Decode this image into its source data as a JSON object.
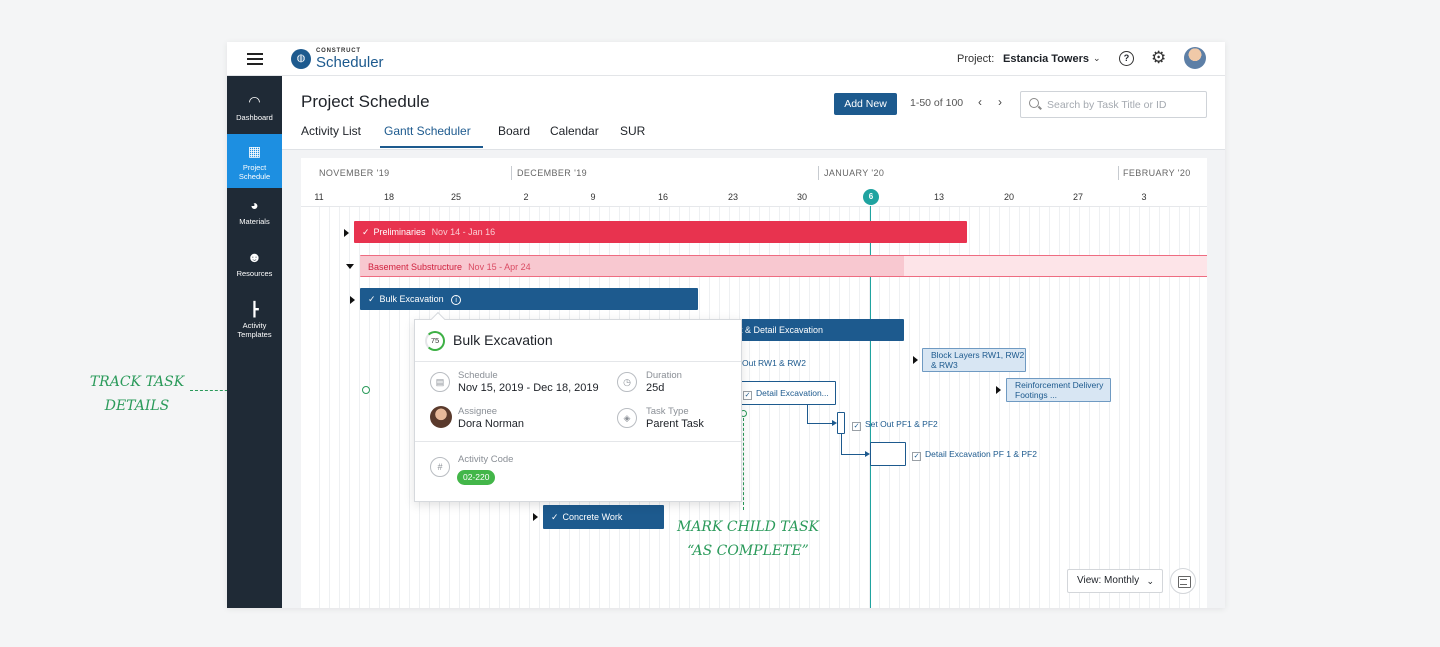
{
  "header": {
    "logo_top": "CONSTRUCT",
    "logo_main": "Scheduler",
    "project_label": "Project:",
    "project_name": "Estancia Towers",
    "help_glyph": "?"
  },
  "sidebar": {
    "items": [
      {
        "label": "Dashboard",
        "icon": "dashboard-gauge-icon"
      },
      {
        "label": "Project Schedule",
        "icon": "calendar-icon"
      },
      {
        "label": "Materials",
        "icon": "pie-chart-icon"
      },
      {
        "label": "Resources",
        "icon": "person-plus-icon"
      },
      {
        "label": "Activity Templates",
        "icon": "hierarchy-icon"
      }
    ]
  },
  "page": {
    "title": "Project Schedule",
    "tabs": [
      "Activity List",
      "Gantt Scheduler",
      "Board",
      "Calendar",
      "SUR"
    ],
    "active_tab": "Gantt Scheduler",
    "add_button": "Add New",
    "pagination": "1-50 of 100",
    "search_placeholder": "Search by Task Title or ID"
  },
  "gantt": {
    "months": [
      "NOVEMBER '19",
      "DECEMBER '19",
      "JANUARY '20",
      "FEBRUARY '20"
    ],
    "days": [
      "11",
      "18",
      "25",
      "2",
      "9",
      "16",
      "23",
      "30",
      "6",
      "13",
      "20",
      "27",
      "3"
    ],
    "today": "6",
    "tasks": {
      "preliminaries": {
        "label": "Preliminaries",
        "dates": "Nov 14 - Jan 16"
      },
      "basement": {
        "label": "Basement Substructure",
        "dates": "Nov 15 - Apr 24",
        "progress": 0.64
      },
      "bulk": {
        "label": "Bulk Excavation"
      },
      "setout_detail": {
        "label": "ut & Detail Excavation"
      },
      "setout_rw": {
        "label": "Out RW1 & RW2"
      },
      "detail_exc": {
        "label": "Detail Excavation..."
      },
      "setout_pf": {
        "label": "Set Out PF1 & PF2"
      },
      "detail_pf": {
        "label": "Detail Excavation PF 1 & PF2"
      },
      "block_layers": {
        "label": "Block Layers RW1, RW2 & RW3"
      },
      "reinforcement": {
        "label": "Reinforcement Delivery Footings ..."
      },
      "concrete": {
        "label": "Concrete Work"
      }
    }
  },
  "popover": {
    "progress": "75",
    "title": "Bulk Excavation",
    "schedule_label": "Schedule",
    "schedule_value": "Nov 15, 2019 - Dec 18, 2019",
    "duration_label": "Duration",
    "duration_value": "25d",
    "assignee_label": "Assignee",
    "assignee_value": "Dora Norman",
    "type_label": "Task Type",
    "type_value": "Parent Task",
    "code_label": "Activity Code",
    "code_value": "02-220"
  },
  "controls": {
    "view_select": "View: Monthly"
  },
  "annotations": {
    "track_line1": "TRACK TASK",
    "track_line2": "DETAILS",
    "mark_line1": "MARK CHILD TASK",
    "mark_line2": "“AS COMPLETE”"
  },
  "colors": {
    "brand_blue": "#1d5a8e",
    "active_nav": "#1d8fe1",
    "critical_red": "#e8334f",
    "today_teal": "#1fa3a0",
    "annotation_green": "#2a9a5a"
  }
}
